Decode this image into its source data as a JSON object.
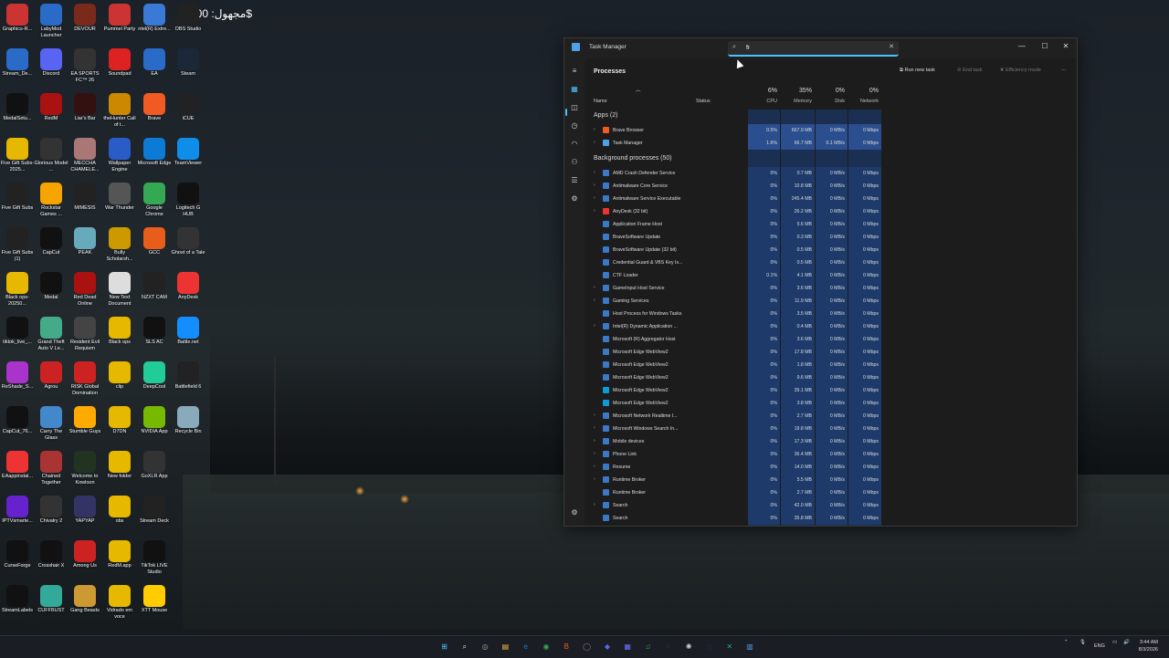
{
  "overlay": {
    "price_text": "مجهول: 10.00$"
  },
  "desktop_icons": [
    {
      "label": "Graphics-R...",
      "color": "#c33"
    },
    {
      "label": "LabyMod Launcher",
      "color": "#2a6bc8"
    },
    {
      "label": "DEVOUR",
      "color": "#7a2a1a"
    },
    {
      "label": "Pummel Party",
      "color": "#c33"
    },
    {
      "label": "ntel(R) Extre...",
      "color": "#3a7ad6"
    },
    {
      "label": "OBS Studio",
      "color": "#222"
    },
    {
      "label": "Stream_De...",
      "color": "#2a6bc8"
    },
    {
      "label": "Discord",
      "color": "#5865f2"
    },
    {
      "label": "EA SPORTS FC™ 26",
      "color": "#333"
    },
    {
      "label": "Soundpad",
      "color": "#d22"
    },
    {
      "label": "EA",
      "color": "#2a6bc8"
    },
    {
      "label": "Steam",
      "color": "#1b2838"
    },
    {
      "label": "MedalSetu...",
      "color": "#111"
    },
    {
      "label": "RedM",
      "color": "#a11"
    },
    {
      "label": "Liar's Bar",
      "color": "#311"
    },
    {
      "label": "theHunter Call of t...",
      "color": "#c80"
    },
    {
      "label": "Brave",
      "color": "#f15a22"
    },
    {
      "label": "iCUE",
      "color": "#222"
    },
    {
      "label": "Five Gift Subs-2025...",
      "color": "#e6b800"
    },
    {
      "label": "Glorious Model ...",
      "color": "#333"
    },
    {
      "label": "MECCHA CHAMELE...",
      "color": "#a77"
    },
    {
      "label": "Wallpaper Engine",
      "color": "#2a5cc8"
    },
    {
      "label": "Microsoft Edge",
      "color": "#0c7bd6"
    },
    {
      "label": "TeamViewer",
      "color": "#0e8ee9"
    },
    {
      "label": "Five Gift Subs",
      "color": "#222"
    },
    {
      "label": "Rockstar Games ...",
      "color": "#f5a400"
    },
    {
      "label": "MIMESIS",
      "color": "#222"
    },
    {
      "label": "War Thunder",
      "color": "#555"
    },
    {
      "label": "Google Chrome",
      "color": "#34a853"
    },
    {
      "label": "Logitech G HUB",
      "color": "#111"
    },
    {
      "label": "Five Gift Subs (1)",
      "color": "#222"
    },
    {
      "label": "CapCut",
      "color": "#111"
    },
    {
      "label": "PEAK",
      "color": "#6ab"
    },
    {
      "label": "Bully Scholarsh...",
      "color": "#c90"
    },
    {
      "label": "GCC",
      "color": "#e85d1a"
    },
    {
      "label": "Ghost of a Tale",
      "color": "#333"
    },
    {
      "label": "Black ops-20250...",
      "color": "#e6b800"
    },
    {
      "label": "Medal",
      "color": "#111"
    },
    {
      "label": "Red Dead Online",
      "color": "#a11"
    },
    {
      "label": "New Text Document",
      "color": "#ddd"
    },
    {
      "label": "NZXT CAM",
      "color": "#222"
    },
    {
      "label": "AnyDesk",
      "color": "#e33"
    },
    {
      "label": "tiktok_live_...",
      "color": "#111"
    },
    {
      "label": "Grand Theft Auto V Le...",
      "color": "#4a8"
    },
    {
      "label": "Resident Evil Requiem",
      "color": "#444"
    },
    {
      "label": "Black ops",
      "color": "#e6b800"
    },
    {
      "label": "SLS AC",
      "color": "#111"
    },
    {
      "label": "Battle.net",
      "color": "#148eff"
    },
    {
      "label": "ReShade_S...",
      "color": "#a3c"
    },
    {
      "label": "Agrou",
      "color": "#c22"
    },
    {
      "label": "RISK Global Domination",
      "color": "#c22"
    },
    {
      "label": "clip",
      "color": "#e6b800"
    },
    {
      "label": "DeepCool",
      "color": "#2c9"
    },
    {
      "label": "Battlefield 6",
      "color": "#222"
    },
    {
      "label": "CapCut_76...",
      "color": "#111"
    },
    {
      "label": "Carry The Glass",
      "color": "#48c"
    },
    {
      "label": "Stumble Guys",
      "color": "#fa0"
    },
    {
      "label": "D7DN",
      "color": "#e6b800"
    },
    {
      "label": "NVIDIA App",
      "color": "#76b900"
    },
    {
      "label": "Recycle Bin",
      "color": "#8ab"
    },
    {
      "label": "EAappinstal...",
      "color": "#e33"
    },
    {
      "label": "Chained Together",
      "color": "#a33"
    },
    {
      "label": "Welcome to Kowloon",
      "color": "#232"
    },
    {
      "label": "New folder",
      "color": "#e6b800"
    },
    {
      "label": "GoXLR App",
      "color": "#333"
    },
    {
      "label": "IPTVsmarte...",
      "color": "#62c"
    },
    {
      "label": "Chivalry 2",
      "color": "#333"
    },
    {
      "label": "YAPYAP",
      "color": "#336"
    },
    {
      "label": "obs",
      "color": "#e6b800"
    },
    {
      "label": "Stream Deck",
      "color": "#222"
    },
    {
      "label": "CurseForge",
      "color": "#111"
    },
    {
      "label": "Crosshair X",
      "color": "#111"
    },
    {
      "label": "Among Us",
      "color": "#c22"
    },
    {
      "label": "RedM.app",
      "color": "#e6b800"
    },
    {
      "label": "TikTok LIVE Studio",
      "color": "#111"
    },
    {
      "label": "StreamLabels",
      "color": "#111"
    },
    {
      "label": "CUFFBUST",
      "color": "#3a9"
    },
    {
      "label": "Gang Beasts",
      "color": "#c93"
    },
    {
      "label": "Vidrado em voce",
      "color": "#e6b800"
    },
    {
      "label": "XTT Mouse",
      "color": "#fc0"
    }
  ],
  "task_manager": {
    "title": "Task Manager",
    "search": {
      "value": "fi",
      "placeholder": "Type a name, publisher, or PID to search"
    },
    "page_title": "Processes",
    "toolbar": {
      "run_new_task": "Run new task",
      "end_task": "End task",
      "efficiency_mode": "Efficiency mode",
      "more": "···"
    },
    "columns": {
      "name": "Name",
      "status": "Status",
      "cpu_pct": "6%",
      "cpu": "CPU",
      "mem_pct": "35%",
      "mem": "Memory",
      "disk_pct": "0%",
      "disk": "Disk",
      "net_pct": "0%",
      "net": "Network"
    },
    "apps_header": "Apps (2)",
    "apps": [
      {
        "name": "Brave Browser",
        "cpu": "0.5%",
        "mem": "667.9 MB",
        "disk": "0 MB/s",
        "net": "0 Mbps",
        "icon_color": "#f15a22",
        "exp": true
      },
      {
        "name": "Task Manager",
        "cpu": "1.6%",
        "mem": "66.7 MB",
        "disk": "0.1 MB/s",
        "net": "0 Mbps",
        "icon_color": "#4ea1e8",
        "exp": true
      }
    ],
    "bg_header": "Background processes (50)",
    "background": [
      {
        "name": "AMD Crash Defender Service",
        "cpu": "0%",
        "mem": "0.7 MB",
        "disk": "0 MB/s",
        "net": "0 Mbps",
        "icon_color": "#3a78c8",
        "exp": true
      },
      {
        "name": "Antimalware Core Service",
        "cpu": "0%",
        "mem": "10.8 MB",
        "disk": "0 MB/s",
        "net": "0 Mbps",
        "icon_color": "#3a78c8",
        "exp": true
      },
      {
        "name": "Antimalware Service Executable",
        "cpu": "0%",
        "mem": "245.4 MB",
        "disk": "0 MB/s",
        "net": "0 Mbps",
        "icon_color": "#3a78c8",
        "exp": true
      },
      {
        "name": "AnyDesk (32 bit)",
        "cpu": "0%",
        "mem": "26.2 MB",
        "disk": "0 MB/s",
        "net": "0 Mbps",
        "icon_color": "#e33",
        "exp": true
      },
      {
        "name": "Application Frame Host",
        "cpu": "0%",
        "mem": "5.6 MB",
        "disk": "0 MB/s",
        "net": "0 Mbps",
        "icon_color": "#3a78c8",
        "exp": false
      },
      {
        "name": "BraveSoftware Update",
        "cpu": "0%",
        "mem": "0.3 MB",
        "disk": "0 MB/s",
        "net": "0 Mbps",
        "icon_color": "#3a78c8",
        "exp": false
      },
      {
        "name": "BraveSoftware Update (32 bit)",
        "cpu": "0%",
        "mem": "0.5 MB",
        "disk": "0 MB/s",
        "net": "0 Mbps",
        "icon_color": "#3a78c8",
        "exp": false
      },
      {
        "name": "Credential Guard & VBS Key Is...",
        "cpu": "0%",
        "mem": "0.5 MB",
        "disk": "0 MB/s",
        "net": "0 Mbps",
        "icon_color": "#3a78c8",
        "exp": false
      },
      {
        "name": "CTF Loader",
        "cpu": "0.1%",
        "mem": "4.1 MB",
        "disk": "0 MB/s",
        "net": "0 Mbps",
        "icon_color": "#3a78c8",
        "exp": false
      },
      {
        "name": "GameInput Host Service",
        "cpu": "0%",
        "mem": "3.6 MB",
        "disk": "0 MB/s",
        "net": "0 Mbps",
        "icon_color": "#3a78c8",
        "exp": true
      },
      {
        "name": "Gaming Services",
        "cpu": "0%",
        "mem": "11.9 MB",
        "disk": "0 MB/s",
        "net": "0 Mbps",
        "icon_color": "#3a78c8",
        "exp": true
      },
      {
        "name": "Host Process for Windows Tasks",
        "cpu": "0%",
        "mem": "3.5 MB",
        "disk": "0 MB/s",
        "net": "0 Mbps",
        "icon_color": "#3a78c8",
        "exp": false
      },
      {
        "name": "Intel(R) Dynamic Application ...",
        "cpu": "0%",
        "mem": "0.4 MB",
        "disk": "0 MB/s",
        "net": "0 Mbps",
        "icon_color": "#3a78c8",
        "exp": true
      },
      {
        "name": "Microsoft (R) Aggregator Host",
        "cpu": "0%",
        "mem": "3.6 MB",
        "disk": "0 MB/s",
        "net": "0 Mbps",
        "icon_color": "#3a78c8",
        "exp": false
      },
      {
        "name": "Microsoft Edge WebView2",
        "cpu": "0%",
        "mem": "17.8 MB",
        "disk": "0 MB/s",
        "net": "0 Mbps",
        "icon_color": "#3a78c8",
        "exp": false
      },
      {
        "name": "Microsoft Edge WebView2",
        "cpu": "0%",
        "mem": "1.8 MB",
        "disk": "0 MB/s",
        "net": "0 Mbps",
        "icon_color": "#3a78c8",
        "exp": false
      },
      {
        "name": "Microsoft Edge WebView2",
        "cpu": "0%",
        "mem": "9.6 MB",
        "disk": "0 MB/s",
        "net": "0 Mbps",
        "icon_color": "#3a78c8",
        "exp": false
      },
      {
        "name": "Microsoft Edge WebView2",
        "cpu": "0%",
        "mem": "39.1 MB",
        "disk": "0 MB/s",
        "net": "0 Mbps",
        "icon_color": "#0c9bd6",
        "exp": false
      },
      {
        "name": "Microsoft Edge WebView2",
        "cpu": "0%",
        "mem": "3.8 MB",
        "disk": "0 MB/s",
        "net": "0 Mbps",
        "icon_color": "#0c9bd6",
        "exp": false
      },
      {
        "name": "Microsoft Network Realtime I...",
        "cpu": "0%",
        "mem": "2.7 MB",
        "disk": "0 MB/s",
        "net": "0 Mbps",
        "icon_color": "#3a78c8",
        "exp": true
      },
      {
        "name": "Microsoft Windows Search In...",
        "cpu": "0%",
        "mem": "19.8 MB",
        "disk": "0 MB/s",
        "net": "0 Mbps",
        "icon_color": "#3a78c8",
        "exp": true
      },
      {
        "name": "Mobile devices",
        "cpu": "0%",
        "mem": "17.3 MB",
        "disk": "0 MB/s",
        "net": "0 Mbps",
        "icon_color": "#3a78c8",
        "exp": true
      },
      {
        "name": "Phone Link",
        "cpu": "0%",
        "mem": "36.4 MB",
        "disk": "0 MB/s",
        "net": "0 Mbps",
        "icon_color": "#3a78c8",
        "exp": true
      },
      {
        "name": "Resume",
        "cpu": "0%",
        "mem": "14.0 MB",
        "disk": "0 MB/s",
        "net": "0 Mbps",
        "icon_color": "#3a78c8",
        "exp": true
      },
      {
        "name": "Runtime Broker",
        "cpu": "0%",
        "mem": "5.5 MB",
        "disk": "0 MB/s",
        "net": "0 Mbps",
        "icon_color": "#3a78c8",
        "exp": true
      },
      {
        "name": "Runtime Broker",
        "cpu": "0%",
        "mem": "2.7 MB",
        "disk": "0 MB/s",
        "net": "0 Mbps",
        "icon_color": "#3a78c8",
        "exp": false
      },
      {
        "name": "Search",
        "cpu": "0%",
        "mem": "42.0 MB",
        "disk": "0 MB/s",
        "net": "0 Mbps",
        "icon_color": "#3a78c8",
        "exp": true
      },
      {
        "name": "Search",
        "cpu": "0%",
        "mem": "35.8 MB",
        "disk": "0 MB/s",
        "net": "0 Mbps",
        "icon_color": "#3a78c8",
        "exp": false
      }
    ]
  },
  "taskbar": {
    "icons": [
      "windows-start",
      "search",
      "copilot",
      "file-explorer",
      "edge",
      "chrome",
      "brave",
      "nzxt",
      "discord",
      "streamdeck",
      "spotify",
      "terminal",
      "chatgpt",
      "steam",
      "goxlr",
      "task-manager"
    ],
    "lang": "ENG",
    "time": "3:44 AM",
    "date": "8/3/2026"
  }
}
